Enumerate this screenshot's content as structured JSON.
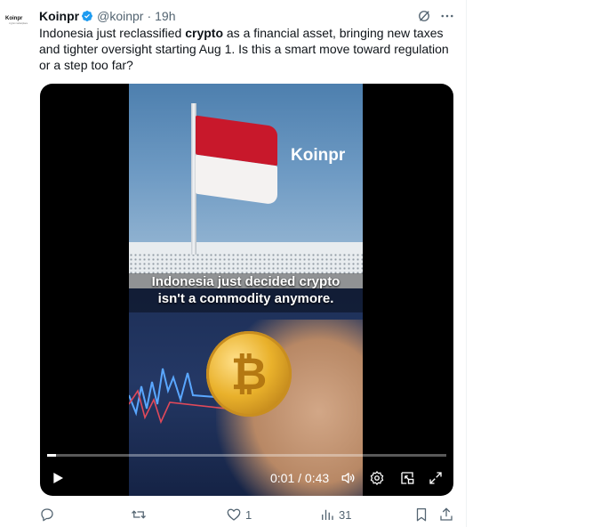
{
  "tweet": {
    "author_name": "Koinpr",
    "author_handle": "@koinpr",
    "separator": "·",
    "timestamp": "19h",
    "avatar_logo": "Koinpr",
    "avatar_tagline": "crypto marketplace",
    "text": {
      "line1_before": "Indonesia just reclassified ",
      "line1_bold": "crypto",
      "line1_after": " as a financial asset, bringing new taxes",
      "line2": "and tighter oversight starting Aug 1. Is this a smart move toward regulation",
      "line3": "or a step too far?"
    }
  },
  "media": {
    "watermark": "Koinpr",
    "caption_line1": "Indonesia just decided crypto",
    "caption_line2": "isn't a commodity anymore.",
    "coin_symbol": "₿",
    "playback": {
      "time_display": "0:01 / 0:43",
      "progress_fraction": 0.023
    }
  },
  "actions": {
    "replies": "",
    "reposts": "",
    "likes": "1",
    "views": "31"
  },
  "icons": {
    "verified": "verified-badge-icon",
    "grok": "grok-icon",
    "more": "more-icon",
    "reply": "reply-icon",
    "repost": "repost-icon",
    "like": "like-icon",
    "views": "views-icon",
    "bookmark": "bookmark-icon",
    "share": "share-icon",
    "play": "play-icon",
    "volume": "volume-icon",
    "settings": "settings-icon",
    "pip": "picture-in-picture-icon",
    "fullscreen": "fullscreen-icon"
  },
  "colors": {
    "verified_blue": "#1d9bf0",
    "secondary_text": "#536471",
    "flag_red": "#c8182b"
  }
}
